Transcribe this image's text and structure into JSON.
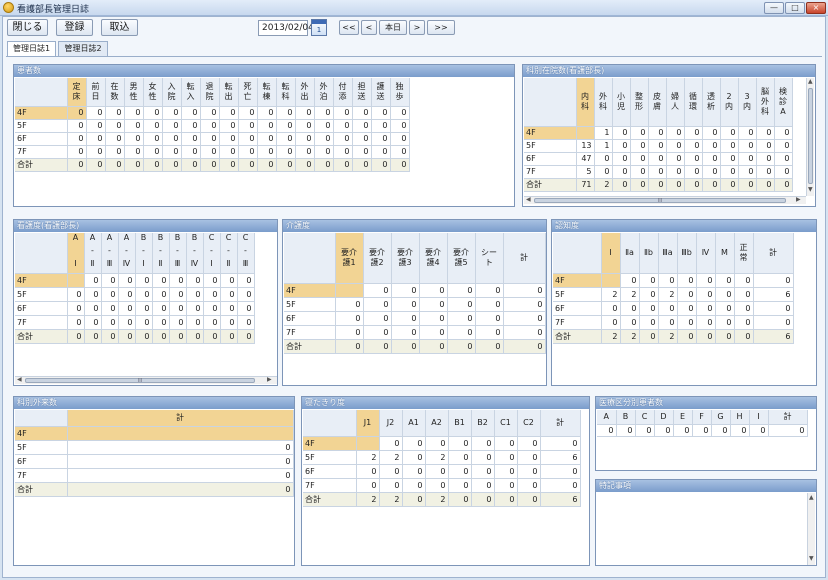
{
  "window": {
    "title": "看護部長管理日誌",
    "min": "—",
    "max": "□",
    "close": "×"
  },
  "toolbar": {
    "close_label": "閉じる",
    "register_label": "登録",
    "import_label": "取込",
    "date": "2013/02/04",
    "cal_day": "1",
    "nav_first": "<<",
    "nav_prev": "<",
    "nav_today": "本日",
    "nav_next": ">",
    "nav_last": ">>"
  },
  "tabs": [
    {
      "label": "管理日誌1"
    },
    {
      "label": "管理日誌2"
    }
  ],
  "rows": [
    "4F",
    "5F",
    "6F",
    "7F",
    "合計"
  ],
  "patients": {
    "title": "患者数",
    "cols": [
      "定床",
      "前日",
      "在数",
      "男性",
      "女性",
      "入院",
      "転入",
      "退院",
      "転出",
      "死亡",
      "転棟",
      "転科",
      "外出",
      "外泊",
      "付添",
      "担送",
      "護送",
      "独歩"
    ],
    "data": [
      [
        "0",
        "0",
        "0",
        "0",
        "0",
        "0",
        "0",
        "0",
        "0",
        "0",
        "0",
        "0",
        "0",
        "0",
        "0",
        "0",
        "0",
        "0"
      ],
      [
        "0",
        "0",
        "0",
        "0",
        "0",
        "0",
        "0",
        "0",
        "0",
        "0",
        "0",
        "0",
        "0",
        "0",
        "0",
        "0",
        "0",
        "0"
      ],
      [
        "0",
        "0",
        "0",
        "0",
        "0",
        "0",
        "0",
        "0",
        "0",
        "0",
        "0",
        "0",
        "0",
        "0",
        "0",
        "0",
        "0",
        "0"
      ],
      [
        "0",
        "0",
        "0",
        "0",
        "0",
        "0",
        "0",
        "0",
        "0",
        "0",
        "0",
        "0",
        "0",
        "0",
        "0",
        "0",
        "0",
        "0"
      ],
      [
        "0",
        "0",
        "0",
        "0",
        "0",
        "0",
        "0",
        "0",
        "0",
        "0",
        "0",
        "0",
        "0",
        "0",
        "0",
        "0",
        "0",
        "0"
      ]
    ]
  },
  "dept_inpatients": {
    "title": "科別在院数(看護部長)",
    "cols": [
      "内科",
      "外科",
      "小児",
      "整形",
      "皮膚",
      "婦人",
      "循環",
      "透析",
      "2内",
      "3内",
      "脳外科",
      "検診A"
    ],
    "data": [
      [
        "",
        "1",
        "0",
        "0",
        "0",
        "0",
        "0",
        "0",
        "0",
        "0",
        "0",
        "0"
      ],
      [
        "13",
        "1",
        "0",
        "0",
        "0",
        "0",
        "0",
        "0",
        "0",
        "0",
        "0",
        "0"
      ],
      [
        "47",
        "0",
        "0",
        "0",
        "0",
        "0",
        "0",
        "0",
        "0",
        "0",
        "0",
        "0"
      ],
      [
        "5",
        "0",
        "0",
        "0",
        "0",
        "0",
        "0",
        "0",
        "0",
        "0",
        "0",
        "0"
      ],
      [
        "71",
        "2",
        "0",
        "0",
        "0",
        "0",
        "0",
        "0",
        "0",
        "0",
        "0",
        "0"
      ]
    ]
  },
  "nursing": {
    "title": "看護度(看護部長)",
    "cols_top": [
      "A",
      "A",
      "A",
      "A",
      "B",
      "B",
      "B",
      "B",
      "C",
      "C",
      "C"
    ],
    "cols_mid": [
      "",
      "-",
      "-",
      "-",
      "-",
      "-",
      "-",
      "-",
      "-",
      "-",
      "-"
    ],
    "cols_bot": [
      "I",
      "Ⅱ",
      "Ⅲ",
      "Ⅳ",
      "I",
      "Ⅱ",
      "Ⅲ",
      "Ⅳ",
      "I",
      "Ⅱ",
      "Ⅲ"
    ],
    "data": [
      [
        "",
        "0",
        "0",
        "0",
        "0",
        "0",
        "0",
        "0",
        "0",
        "0",
        "0"
      ],
      [
        "0",
        "0",
        "0",
        "0",
        "0",
        "0",
        "0",
        "0",
        "0",
        "0",
        "0"
      ],
      [
        "0",
        "0",
        "0",
        "0",
        "0",
        "0",
        "0",
        "0",
        "0",
        "0",
        "0"
      ],
      [
        "0",
        "0",
        "0",
        "0",
        "0",
        "0",
        "0",
        "0",
        "0",
        "0",
        "0"
      ],
      [
        "0",
        "0",
        "0",
        "0",
        "0",
        "0",
        "0",
        "0",
        "0",
        "0",
        "0"
      ]
    ]
  },
  "care": {
    "title": "介護度",
    "cols": [
      "要介護1",
      "要介護2",
      "要介護3",
      "要介護4",
      "要介護5",
      "シート",
      "計"
    ],
    "data": [
      [
        "",
        "0",
        "0",
        "0",
        "0",
        "0",
        "0"
      ],
      [
        "0",
        "0",
        "0",
        "0",
        "0",
        "0",
        "0"
      ],
      [
        "0",
        "0",
        "0",
        "0",
        "0",
        "0",
        "0"
      ],
      [
        "0",
        "0",
        "0",
        "0",
        "0",
        "0",
        "0"
      ],
      [
        "0",
        "0",
        "0",
        "0",
        "0",
        "0",
        "0"
      ]
    ]
  },
  "cognitive": {
    "title": "認知度",
    "cols": [
      "I",
      "Ⅱa",
      "Ⅱb",
      "Ⅲa",
      "Ⅲb",
      "Ⅳ",
      "M",
      "正常",
      "計"
    ],
    "data": [
      [
        "",
        "0",
        "0",
        "0",
        "0",
        "0",
        "0",
        "0",
        "0"
      ],
      [
        "2",
        "2",
        "0",
        "2",
        "0",
        "0",
        "0",
        "0",
        "6"
      ],
      [
        "0",
        "0",
        "0",
        "0",
        "0",
        "0",
        "0",
        "0",
        "0"
      ],
      [
        "0",
        "0",
        "0",
        "0",
        "0",
        "0",
        "0",
        "0",
        "0"
      ],
      [
        "2",
        "2",
        "0",
        "2",
        "0",
        "0",
        "0",
        "0",
        "6"
      ]
    ]
  },
  "outpatients": {
    "title": "科別外来数",
    "cols": [
      "計"
    ],
    "data": [
      [
        ""
      ],
      [
        "0"
      ],
      [
        "0"
      ],
      [
        "0"
      ],
      [
        "0"
      ]
    ]
  },
  "bedridden": {
    "title": "寝たきり度",
    "cols": [
      "J1",
      "J2",
      "A1",
      "A2",
      "B1",
      "B2",
      "C1",
      "C2",
      "計"
    ],
    "data": [
      [
        "",
        "0",
        "0",
        "0",
        "0",
        "0",
        "0",
        "0",
        "0"
      ],
      [
        "2",
        "2",
        "0",
        "2",
        "0",
        "0",
        "0",
        "0",
        "6"
      ],
      [
        "0",
        "0",
        "0",
        "0",
        "0",
        "0",
        "0",
        "0",
        "0"
      ],
      [
        "0",
        "0",
        "0",
        "0",
        "0",
        "0",
        "0",
        "0",
        "0"
      ],
      [
        "2",
        "2",
        "0",
        "2",
        "0",
        "0",
        "0",
        "0",
        "6"
      ]
    ]
  },
  "medical_class": {
    "title": "医療区分別患者数",
    "cols": [
      "A",
      "B",
      "C",
      "D",
      "E",
      "F",
      "G",
      "H",
      "I",
      "計"
    ],
    "data": [
      [
        "0",
        "0",
        "0",
        "0",
        "0",
        "0",
        "0",
        "0",
        "0",
        "0"
      ]
    ]
  },
  "notes": {
    "title": "特記事項",
    "text": ""
  },
  "scroll": {
    "h_mark": "III",
    "up": "▲",
    "down": "▼",
    "left": "◀",
    "right": "▶"
  }
}
